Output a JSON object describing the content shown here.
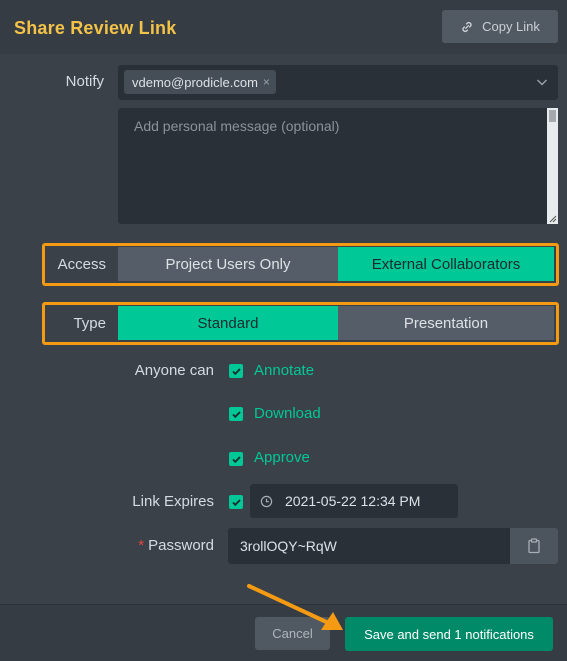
{
  "header": {
    "title": "Share Review Link",
    "copy_link_label": "Copy Link"
  },
  "notify": {
    "label": "Notify",
    "recipients": [
      "vdemo@prodicle.com"
    ],
    "remove_glyph": "×",
    "message_placeholder": "Add personal message (optional)"
  },
  "access": {
    "label": "Access",
    "options": [
      "Project Users Only",
      "External Collaborators"
    ],
    "selected": "External Collaborators"
  },
  "type": {
    "label": "Type",
    "options": [
      "Standard",
      "Presentation"
    ],
    "selected": "Standard"
  },
  "permissions": {
    "label": "Anyone can",
    "items": [
      {
        "label": "Annotate",
        "checked": true
      },
      {
        "label": "Download",
        "checked": true
      },
      {
        "label": "Approve",
        "checked": true
      }
    ]
  },
  "expires": {
    "label": "Link Expires",
    "enabled": true,
    "value": "2021-05-22 12:34 PM"
  },
  "password": {
    "label": "Password",
    "required_marker": "*",
    "value": "3rollOQY~RqW"
  },
  "footer": {
    "cancel_label": "Cancel",
    "save_label": "Save and send 1 notifications"
  },
  "colors": {
    "title": "#f3c248",
    "accent": "#00c896",
    "primary_button": "#008a68",
    "highlight_outline": "#f59b13",
    "background": "#3a4149"
  },
  "icons": {
    "copy": "link-icon",
    "dropdown": "chevron-down-icon",
    "date": "clock-icon",
    "password_action": "clipboard-icon"
  }
}
